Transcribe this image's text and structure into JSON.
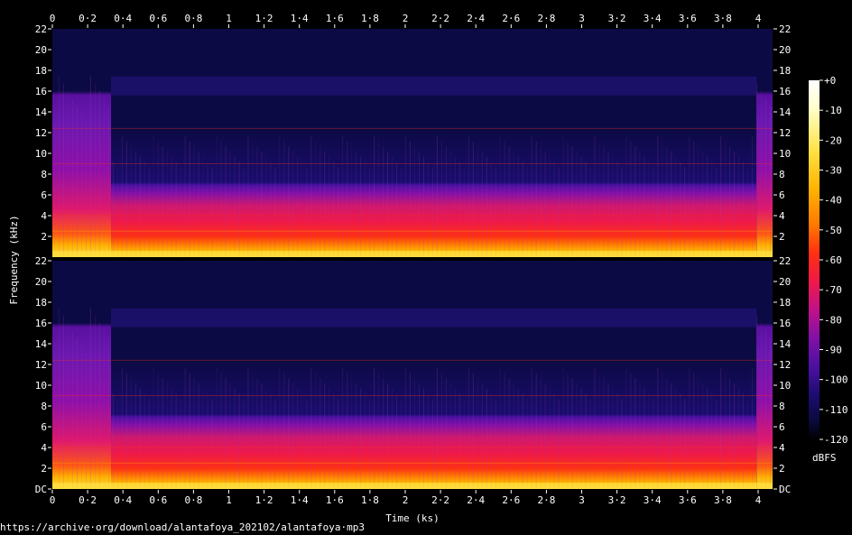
{
  "chart_data": {
    "type": "heatmap",
    "title": "",
    "xlabel": "Time (ks)",
    "ylabel": "Frequency (kHz)",
    "colorbar_label": "dBFS",
    "xlim": [
      0,
      4.05
    ],
    "ylim": [
      0,
      22
    ],
    "x_ticks": [
      "0",
      "0·2",
      "0·4",
      "0·6",
      "0·8",
      "1",
      "1·2",
      "1·4",
      "1·6",
      "1·8",
      "2",
      "2·2",
      "2·4",
      "2·6",
      "2·8",
      "3",
      "3·2",
      "3·4",
      "3·6",
      "3·8",
      "4"
    ],
    "channels": [
      {
        "y_ticks": [
          "22",
          "20",
          "18",
          "16",
          "14",
          "12",
          "10",
          "8",
          "6",
          "4",
          "2"
        ],
        "y_tick_values": [
          22,
          20,
          18,
          16,
          14,
          12,
          10,
          8,
          6,
          4,
          2
        ]
      },
      {
        "y_ticks": [
          "22",
          "20",
          "18",
          "16",
          "14",
          "12",
          "10",
          "8",
          "6",
          "4",
          "2",
          "DC"
        ],
        "y_tick_values": [
          22,
          20,
          18,
          16,
          14,
          12,
          10,
          8,
          6,
          4,
          2,
          0
        ]
      }
    ],
    "colorbar_ticks": [
      "+0",
      "-10",
      "-20",
      "-30",
      "-40",
      "-50",
      "-60",
      "-70",
      "-80",
      "-90",
      "-100",
      "-110",
      "-120"
    ],
    "colorbar_range": [
      -120,
      0
    ],
    "colormap": [
      "#000000",
      "#0a0a3a",
      "#1a0c6e",
      "#4a10a0",
      "#8010a8",
      "#c0108a",
      "#f01848",
      "#ff3010",
      "#ff7a00",
      "#ffb400",
      "#ffe040",
      "#ffffc8",
      "#ffffff"
    ],
    "segments": [
      {
        "t_start": 0.0,
        "t_end": 0.33,
        "cutoff_khz": 18.6,
        "upper_shelf_khz": 16.0
      },
      {
        "t_start": 0.33,
        "t_end": 3.96,
        "cutoff_khz": 12.4,
        "upper_shelf_khz": 16.2
      },
      {
        "t_start": 3.96,
        "t_end": 4.05,
        "cutoff_khz": 18.6,
        "upper_shelf_khz": 16.0
      }
    ],
    "bands": [
      {
        "from_khz": 0,
        "to_khz": 2.5,
        "level_dbfs": -35
      },
      {
        "from_khz": 2.5,
        "to_khz": 4.0,
        "level_dbfs": -52
      },
      {
        "from_khz": 4.0,
        "to_khz": 9.0,
        "level_dbfs": -60
      },
      {
        "from_khz": 9.0,
        "to_khz": 12.4,
        "level_dbfs": -78
      }
    ],
    "background_dbfs": -112
  },
  "source_url": "https://archive·org/download/alantafoya_202102/alantafoya·mp3"
}
